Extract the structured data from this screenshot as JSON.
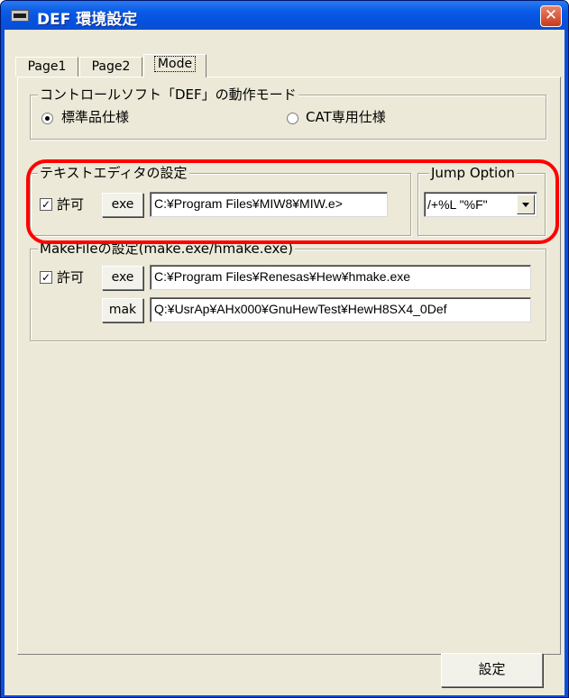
{
  "window": {
    "title": "DEF 環境設定"
  },
  "tabs": [
    {
      "label": "Page1"
    },
    {
      "label": "Page2"
    },
    {
      "label": "Mode"
    }
  ],
  "mode_group": {
    "legend": "コントロールソフト「DEF」の動作モード",
    "options": [
      {
        "label": "標準品仕様",
        "selected": true
      },
      {
        "label": "CAT専用仕様",
        "selected": false
      }
    ]
  },
  "editor_group": {
    "legend": "テキストエディタの設定",
    "allow_label": "許可",
    "allow_checked": true,
    "exe_button": "exe",
    "exe_path": "C:¥Program Files¥MIW8¥MIW.e>"
  },
  "jump_group": {
    "legend": "Jump Option",
    "value": "/+%L \"%F\""
  },
  "makefile_group": {
    "legend": "MakeFileの設定(make.exe/hmake.exe)",
    "allow_label": "許可",
    "allow_checked": true,
    "exe_button": "exe",
    "exe_path": "C:¥Program Files¥Renesas¥Hew¥hmake.exe",
    "mak_button": "mak",
    "mak_path": "Q:¥UsrAp¥AHx000¥GnuHewTest¥HewH8SX4_0Def"
  },
  "footer": {
    "ok_button": "設定"
  },
  "colors": {
    "highlight": "#ff0000",
    "titlebar": "#0a5de6",
    "face": "#ece9d8"
  },
  "icons": {
    "app": "app-icon",
    "close": "close-icon",
    "check": "checkmark-icon",
    "dropdown": "chevron-down-icon"
  }
}
